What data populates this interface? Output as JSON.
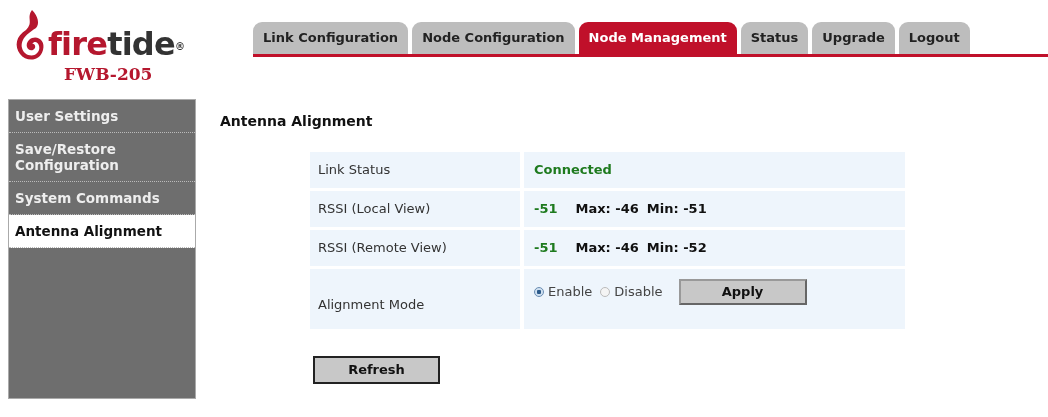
{
  "logo": {
    "word_part_1": "fire",
    "word_part_2": "tide",
    "mark": "®",
    "model": "FWB-205"
  },
  "tabs": [
    {
      "label": "Link Configuration",
      "selected": false
    },
    {
      "label": "Node Configuration",
      "selected": false
    },
    {
      "label": "Node Management",
      "selected": true
    },
    {
      "label": "Status",
      "selected": false
    },
    {
      "label": "Upgrade",
      "selected": false
    },
    {
      "label": "Logout",
      "selected": false
    }
  ],
  "sidebar": {
    "items": [
      {
        "label": "User Settings",
        "selected": false
      },
      {
        "label": "Save/Restore Configuration",
        "selected": false
      },
      {
        "label": "System Commands",
        "selected": false
      },
      {
        "label": "Antenna Alignment",
        "selected": true
      }
    ]
  },
  "heading": "Antenna Alignment",
  "table": {
    "rows": [
      {
        "kind": "status",
        "label": "Link Status",
        "value": "Connected"
      },
      {
        "kind": "rssi",
        "label": "RSSI (Local View)",
        "value": "-51",
        "max": "Max: -46",
        "min": "Min: -51"
      },
      {
        "kind": "rssi",
        "label": "RSSI (Remote View)",
        "value": "-51",
        "max": "Max: -46",
        "min": "Min: -52"
      },
      {
        "kind": "mode",
        "label": "Alignment Mode",
        "options": [
          {
            "label": "Enable",
            "selected": true
          },
          {
            "label": "Disable",
            "selected": false
          }
        ],
        "button": "Apply"
      }
    ]
  },
  "refresh_button": "Refresh"
}
